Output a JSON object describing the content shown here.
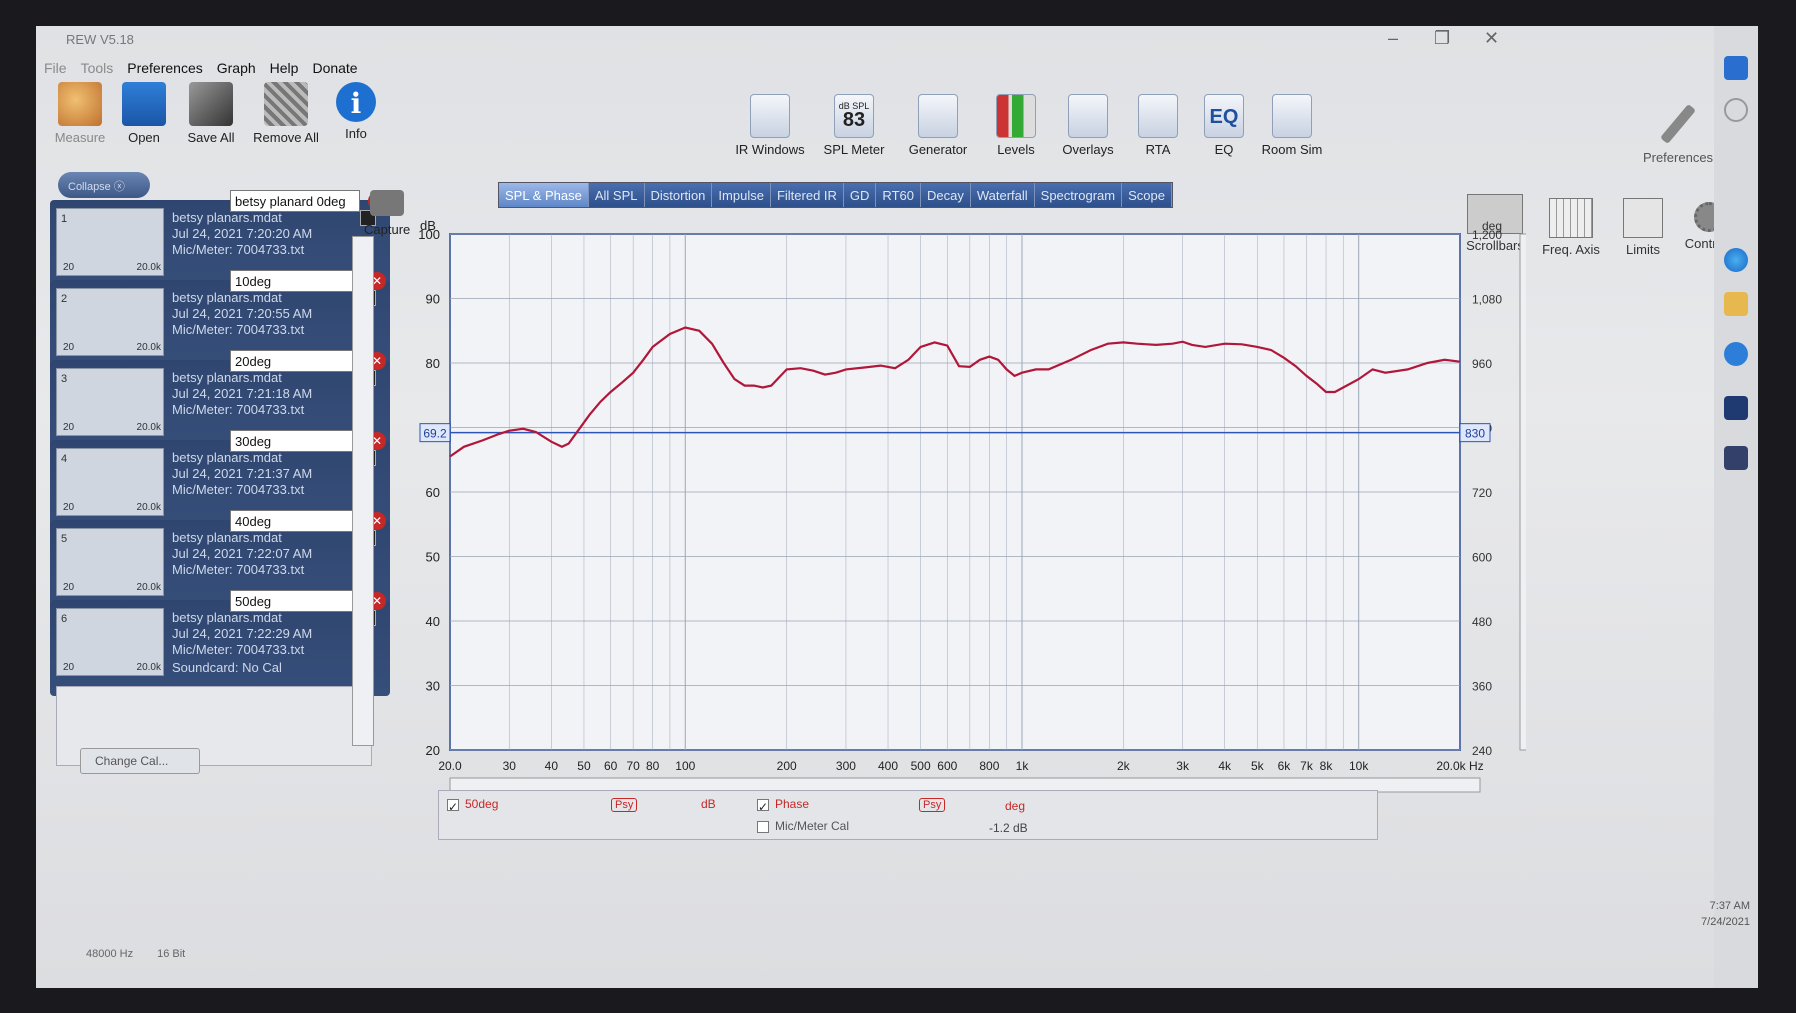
{
  "window": {
    "title": "REW V5.18"
  },
  "menu": {
    "items": [
      "File",
      "Tools",
      "Preferences",
      "Graph",
      "Help",
      "Donate"
    ]
  },
  "toolbar": {
    "left": [
      {
        "label": "Measure",
        "icon": "measure-icon"
      },
      {
        "label": "Open",
        "icon": "folder-icon"
      },
      {
        "label": "Save All",
        "icon": "save-icon"
      },
      {
        "label": "Remove All",
        "icon": "remove-icon"
      },
      {
        "label": "Info",
        "icon": "info-icon"
      }
    ],
    "center": [
      {
        "label": "IR Windows"
      },
      {
        "label": "SPL Meter",
        "value": "83",
        "unit": "dB SPL"
      },
      {
        "label": "Generator"
      },
      {
        "label": "Levels"
      },
      {
        "label": "Overlays"
      },
      {
        "label": "RTA"
      },
      {
        "label": "EQ"
      },
      {
        "label": "Room Sim"
      }
    ],
    "preferences": "Preferences"
  },
  "right_tools": [
    "Scrollbars",
    "Freq. Axis",
    "Limits",
    "Controls"
  ],
  "capture_label": "Capture",
  "collapse_label": "Collapse",
  "measurements": [
    {
      "name": "betsy planard 0deg",
      "num": "1",
      "file": "betsy planars.mdat",
      "date": "Jul 24, 2021 7:20:20 AM",
      "cal": "Mic/Meter: 7004733.txt"
    },
    {
      "name": "10deg",
      "num": "2",
      "file": "betsy planars.mdat",
      "date": "Jul 24, 2021 7:20:55 AM",
      "cal": "Mic/Meter: 7004733.txt"
    },
    {
      "name": "20deg",
      "num": "3",
      "file": "betsy planars.mdat",
      "date": "Jul 24, 2021 7:21:18 AM",
      "cal": "Mic/Meter: 7004733.txt"
    },
    {
      "name": "30deg",
      "num": "4",
      "file": "betsy planars.mdat",
      "date": "Jul 24, 2021 7:21:37 AM",
      "cal": "Mic/Meter: 7004733.txt"
    },
    {
      "name": "40deg",
      "num": "5",
      "file": "betsy planars.mdat",
      "date": "Jul 24, 2021 7:22:07 AM",
      "cal": "Mic/Meter: 7004733.txt"
    },
    {
      "name": "50deg",
      "num": "6",
      "file": "betsy planars.mdat",
      "date": "Jul 24, 2021 7:22:29 AM",
      "cal": "Mic/Meter: 7004733.txt",
      "soundcard": "Soundcard: No Cal"
    }
  ],
  "thumb_axis": {
    "min": "20",
    "max": "20.0k"
  },
  "change_cal": "Change Cal...",
  "tabs": [
    "SPL & Phase",
    "All SPL",
    "Distortion",
    "Impulse",
    "Filtered IR",
    "GD",
    "RT60",
    "Decay",
    "Waterfall",
    "Spectrogram",
    "Scope"
  ],
  "active_tab": "SPL & Phase",
  "legend": {
    "spl_name": "50deg",
    "psy": "Psy",
    "spl_unit": "dB",
    "phase_name": "Phase",
    "phase_unit": "deg",
    "mic_cal": "Mic/Meter Cal",
    "offset": "-1.2 dB"
  },
  "status": {
    "rate": "48000 Hz",
    "bits": "16 Bit"
  },
  "clock": {
    "time": "7:37 AM",
    "date": "7/24/2021"
  },
  "colors": {
    "trace": "#b0173a",
    "grid": "#9aa4b5",
    "cursor": "#2d55b5",
    "panel": "#2f4670"
  },
  "chart_data": {
    "type": "line",
    "xscale": "log",
    "xlim": [
      20,
      20000
    ],
    "ylim": [
      20,
      100
    ],
    "y2lim": [
      240,
      1200
    ],
    "ylabel": "dB",
    "y2label": "deg",
    "xticks": [
      {
        "v": 20,
        "l": "20.0"
      },
      {
        "v": 30,
        "l": "30"
      },
      {
        "v": 40,
        "l": "40"
      },
      {
        "v": 50,
        "l": "50"
      },
      {
        "v": 60,
        "l": "60"
      },
      {
        "v": 70,
        "l": "70"
      },
      {
        "v": 80,
        "l": "80"
      },
      {
        "v": 100,
        "l": "100"
      },
      {
        "v": 200,
        "l": "200"
      },
      {
        "v": 300,
        "l": "300"
      },
      {
        "v": 400,
        "l": "400"
      },
      {
        "v": 500,
        "l": "500"
      },
      {
        "v": 600,
        "l": "600"
      },
      {
        "v": 800,
        "l": "800"
      },
      {
        "v": 1000,
        "l": "1k"
      },
      {
        "v": 2000,
        "l": "2k"
      },
      {
        "v": 3000,
        "l": "3k"
      },
      {
        "v": 4000,
        "l": "4k"
      },
      {
        "v": 5000,
        "l": "5k"
      },
      {
        "v": 6000,
        "l": "6k"
      },
      {
        "v": 7000,
        "l": "7k"
      },
      {
        "v": 8000,
        "l": "8k"
      },
      {
        "v": 10000,
        "l": "10k"
      },
      {
        "v": 20000,
        "l": "20.0k Hz"
      }
    ],
    "yticks": [
      20,
      30,
      40,
      50,
      60,
      70,
      80,
      90,
      100
    ],
    "y2ticks": [
      240,
      360,
      480,
      600,
      720,
      840,
      960,
      1080,
      1200
    ],
    "y2tick_labels": [
      "240",
      "360",
      "480",
      "600",
      "720",
      "840",
      "960",
      "1,080",
      "1,200"
    ],
    "cursor": {
      "y_label": "69.2",
      "y": 69.2,
      "y2_label": "830"
    },
    "series": [
      {
        "name": "50deg",
        "x": [
          20,
          22,
          25,
          28,
          30,
          33,
          36,
          40,
          43,
          45,
          48,
          52,
          56,
          60,
          65,
          70,
          75,
          80,
          90,
          100,
          110,
          120,
          130,
          140,
          150,
          160,
          170,
          180,
          200,
          220,
          240,
          260,
          280,
          300,
          340,
          380,
          420,
          460,
          500,
          550,
          600,
          650,
          700,
          750,
          800,
          850,
          900,
          950,
          1000,
          1100,
          1200,
          1400,
          1600,
          1800,
          2000,
          2200,
          2500,
          2800,
          3000,
          3200,
          3500,
          4000,
          4500,
          5000,
          5500,
          6000,
          6500,
          7000,
          7500,
          8000,
          8500,
          9000,
          10000,
          11000,
          12000,
          14000,
          16000,
          18000,
          20000
        ],
        "values": [
          65.5,
          67,
          68,
          69,
          69.5,
          69.8,
          69.3,
          67.8,
          67,
          67.5,
          69.5,
          72,
          74,
          75.5,
          77,
          78.5,
          80.5,
          82.5,
          84.5,
          85.5,
          85,
          83,
          80,
          77.5,
          76.5,
          76.5,
          76.2,
          76.5,
          79,
          79.2,
          78.8,
          78.2,
          78.5,
          79,
          79.3,
          79.6,
          79.2,
          80.5,
          82.5,
          83.2,
          82.7,
          79.5,
          79.4,
          80.5,
          81,
          80.5,
          79,
          78,
          78.5,
          79,
          79,
          80.5,
          82,
          83,
          83.2,
          83,
          82.8,
          83,
          83.3,
          82.8,
          82.5,
          83,
          82.9,
          82.5,
          82,
          80.8,
          79.5,
          78,
          76.8,
          75.5,
          75.5,
          76.2,
          77.5,
          79,
          78.5,
          79,
          80,
          80.5,
          80.2
        ]
      }
    ]
  }
}
